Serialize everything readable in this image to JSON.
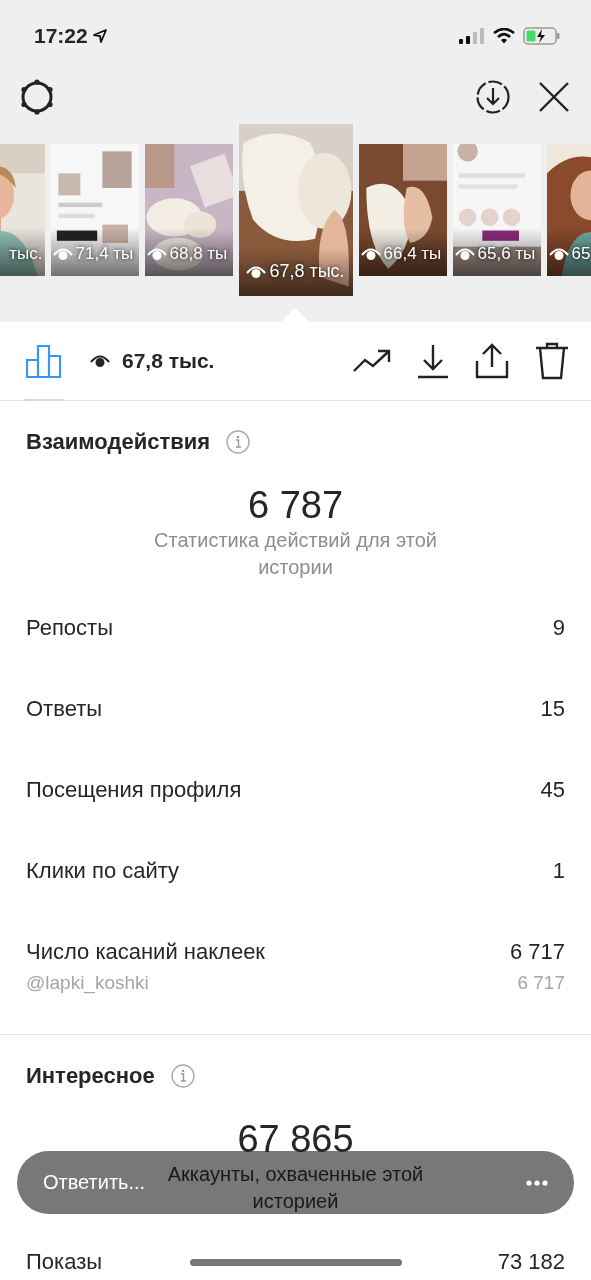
{
  "status_bar": {
    "time": "17:22"
  },
  "thumbnails": [
    {
      "views": "тыс.",
      "selected": false
    },
    {
      "views": "71,4 ты",
      "selected": false
    },
    {
      "views": "68,8 ты",
      "selected": false
    },
    {
      "views": "67,8 тыс.",
      "selected": true
    },
    {
      "views": "66,4 ты",
      "selected": false
    },
    {
      "views": "65,6 ты",
      "selected": false
    },
    {
      "views": "65",
      "selected": false
    }
  ],
  "insights_tab": {
    "selected": true
  },
  "summary": {
    "views": "67,8 тыс."
  },
  "sections": [
    {
      "title": "Взаимодействия",
      "total": "6 787",
      "caption": "Статистика действий для этой истории",
      "rows": [
        {
          "label": "Репосты",
          "value": "9",
          "kind": "main"
        },
        {
          "label": "Ответы",
          "value": "15",
          "kind": "main"
        },
        {
          "label": "Посещения профиля",
          "value": "45",
          "kind": "main"
        },
        {
          "label": "Клики по сайту",
          "value": "1",
          "kind": "main"
        },
        {
          "label": "Число касаний наклеек",
          "value": "6 717",
          "kind": "main"
        },
        {
          "label": "@lapki_koshki",
          "value": "6 717",
          "kind": "sub"
        }
      ]
    },
    {
      "title": "Интересное",
      "total": "67 865",
      "caption": "Аккаунты, охваченные этой историей",
      "rows": [
        {
          "label": "Показы",
          "value": "73 182",
          "kind": "main"
        }
      ]
    }
  ],
  "reply_bar": {
    "placeholder": "Ответить..."
  }
}
